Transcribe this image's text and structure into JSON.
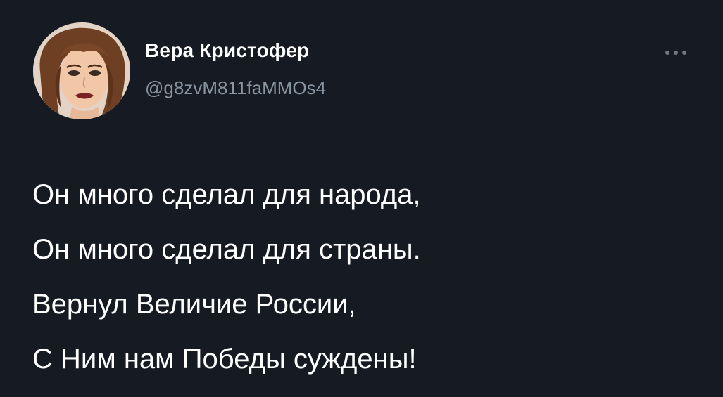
{
  "tweet": {
    "author": {
      "display_name": "Вера Кристофер",
      "handle": "@g8zvM811faMMOs4"
    },
    "more_icon": "more-horizontal-icon",
    "lines": [
      "Он много сделал для народа,",
      "Он много сделал для страны.",
      "Вернул Величие России,",
      "С Ним нам Победы суждены!"
    ]
  },
  "colors": {
    "background": "#161b23",
    "text": "#ffffff",
    "secondary_text": "#8a95a2"
  }
}
